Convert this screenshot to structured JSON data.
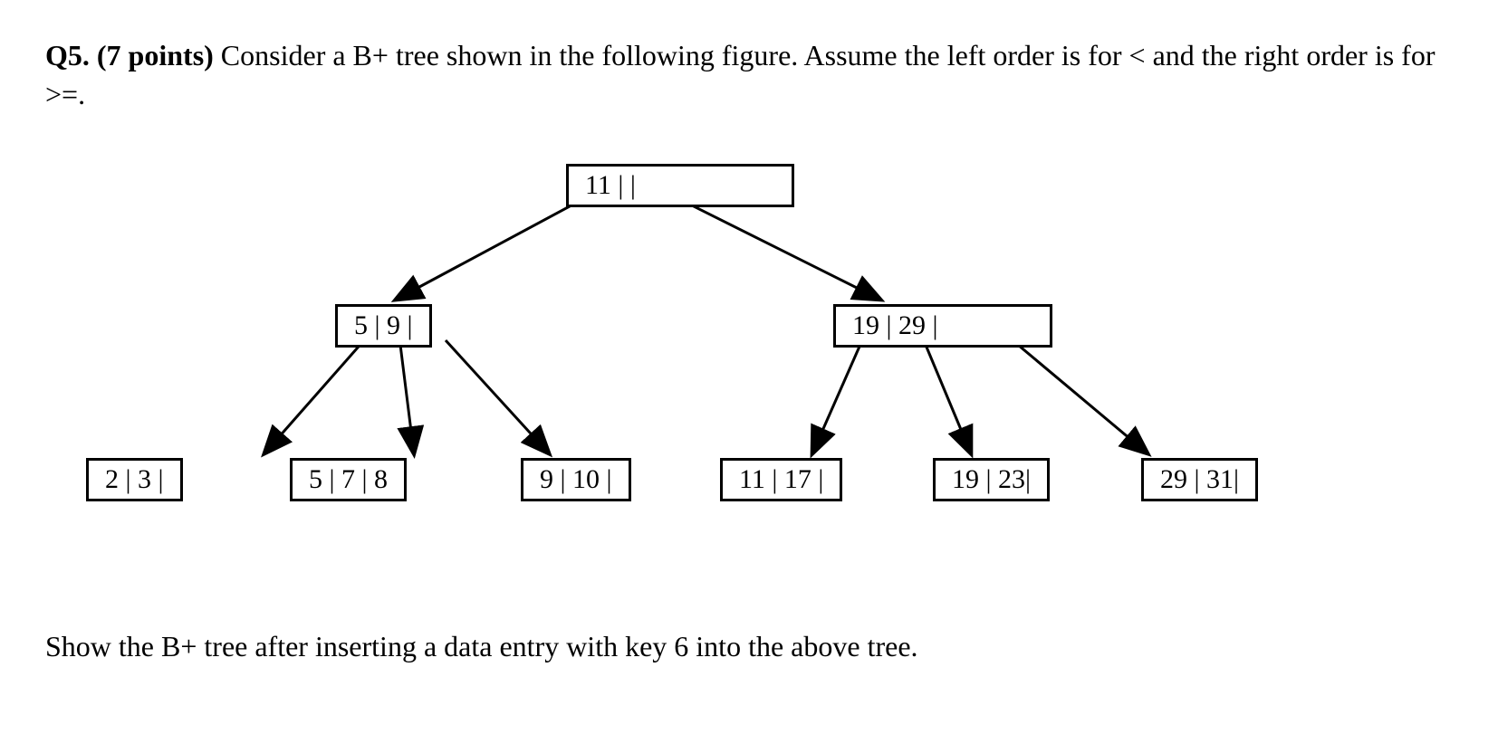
{
  "question": {
    "prefix": "Q5. (7 points) ",
    "body": "Consider a B+ tree shown in the following figure. Assume the left order is for < and the right order is for >=."
  },
  "tree": {
    "root": "11 |     |",
    "internal_left": "5 | 9 |",
    "internal_right": "19  |  29 |",
    "leaf1": "2 | 3 |",
    "leaf2": "5 | 7 | 8",
    "leaf3": "9 | 10 |",
    "leaf4": "11 | 17 |",
    "leaf5": "19  | 23|",
    "leaf6": "29  | 31|"
  },
  "instruction": "Show the B+ tree after inserting a data entry with key 6 into the above tree."
}
